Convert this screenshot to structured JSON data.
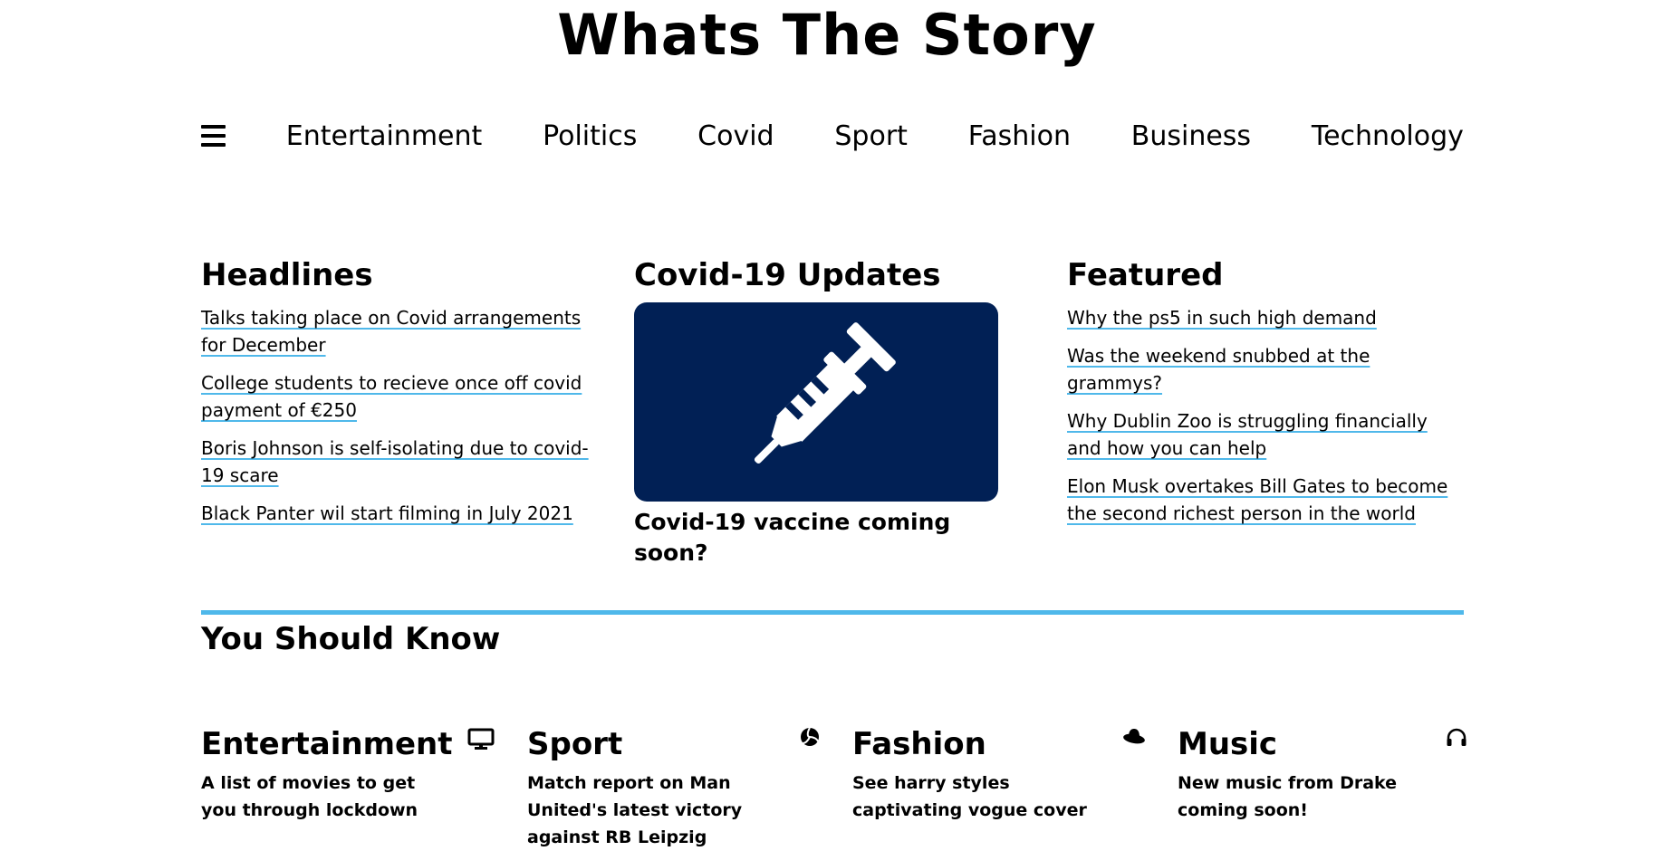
{
  "site": {
    "title": "Whats The Story"
  },
  "nav": {
    "items": [
      "Entertainment",
      "Politics",
      "Covid",
      "Sport",
      "Fashion",
      "Business",
      "Technology"
    ]
  },
  "headlines": {
    "title": "Headlines",
    "links": [
      "Talks taking place on Covid arrangements for December",
      "College students to recieve once off covid payment of €250",
      "Boris Johnson is self-isolating due to covid-19 scare",
      "Black Panter wil start filming in July 2021"
    ]
  },
  "covid": {
    "title": "Covid-19 Updates",
    "caption": "Covid-19 vaccine coming soon?",
    "card_color": "#012055"
  },
  "featured": {
    "title": "Featured",
    "links": [
      "Why the ps5 in such high demand",
      "Was the weekend snubbed at the grammys?",
      "Why Dublin Zoo is struggling financially and how you can help",
      "Elon Musk overtakes Bill Gates to become the second richest person in the world"
    ]
  },
  "you_should_know": {
    "title": "You Should Know",
    "accent": "#4fb8ea",
    "cards": [
      {
        "title": "Entertainment",
        "text": "A list of movies to get you through lockdown",
        "icon": "monitor-icon"
      },
      {
        "title": "Sport",
        "text": "Match report on Man United's latest victory against RB Leipzig",
        "icon": "volleyball-icon"
      },
      {
        "title": "Fashion",
        "text": "See harry styles captivating vogue cover",
        "icon": "hat-icon"
      },
      {
        "title": "Music",
        "text": "New music from Drake coming soon!",
        "icon": "headphones-icon"
      }
    ]
  }
}
